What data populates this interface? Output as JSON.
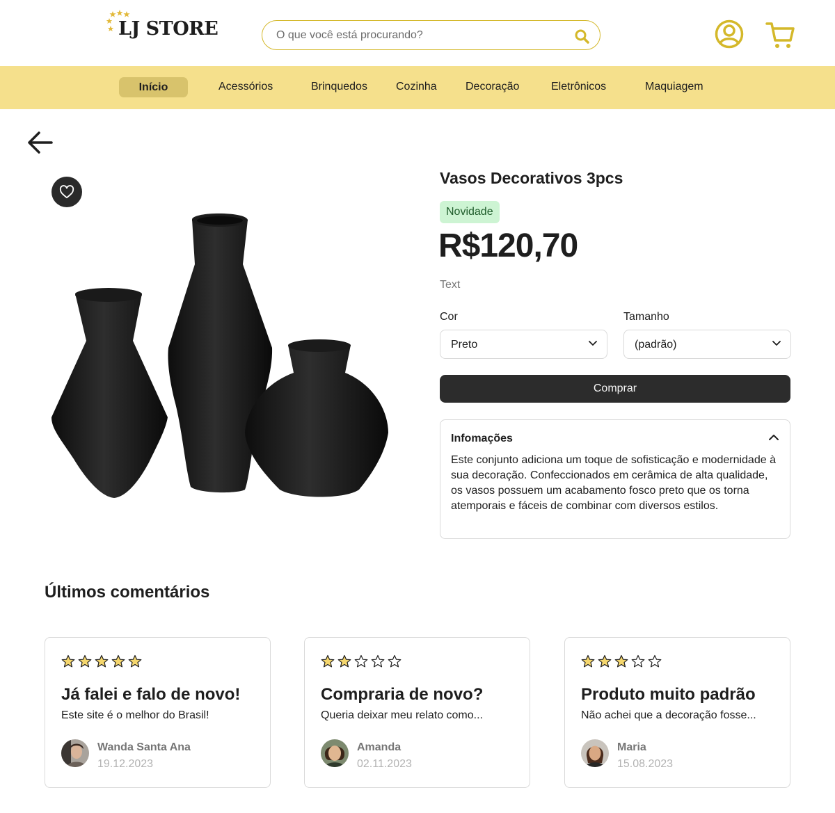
{
  "header": {
    "logo_text": "LJ STORE",
    "search_placeholder": "O que você está procurando?",
    "accent_color": "#d4b82a"
  },
  "nav": {
    "items": [
      {
        "label": "Início",
        "active": true
      },
      {
        "label": "Acessórios"
      },
      {
        "label": "Brinquedos"
      },
      {
        "label": "Cozinha"
      },
      {
        "label": "Decoração"
      },
      {
        "label": "Eletrônicos"
      },
      {
        "label": "Maquiagem"
      }
    ],
    "background": "#f5e08c"
  },
  "product": {
    "title": "Vasos Decorativos 3pcs",
    "badge": "Novidade",
    "price": "R$120,70",
    "subtext": "Text",
    "color_label": "Cor",
    "color_value": "Preto",
    "size_label": "Tamanho",
    "size_value": "(padrão)",
    "buy_label": "Comprar",
    "info_title": "Infomações",
    "info_body": "Este conjunto adiciona um toque de sofisticação e modernidade à sua decoração. Confeccionados em cerâmica de alta qualidade, os vasos possuem um acabamento fosco preto que os torna atemporais e fáceis de combinar com diversos estilos."
  },
  "comments": {
    "title": "Últimos comentários",
    "items": [
      {
        "rating": 5,
        "title": "Já falei e falo de novo!",
        "body": "Este site é o melhor do Brasil!",
        "author": "Wanda Santa Ana",
        "date": "19.12.2023"
      },
      {
        "rating": 2,
        "title": "Compraria de novo?",
        "body": "Queria deixar meu relato como...",
        "author": "Amanda",
        "date": "02.11.2023"
      },
      {
        "rating": 3,
        "title": "Produto muito padrão",
        "body": "Não achei que a decoração fosse...",
        "author": "Maria",
        "date": "15.08.2023"
      }
    ]
  }
}
